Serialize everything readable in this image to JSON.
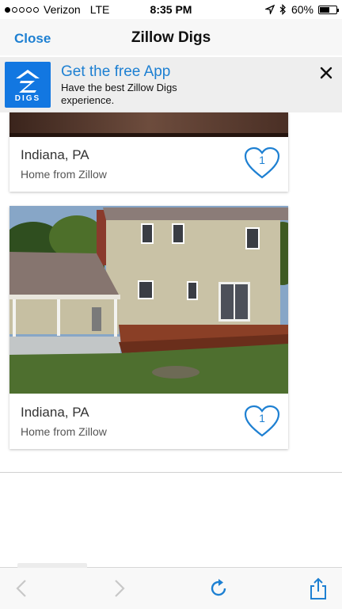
{
  "status_bar": {
    "carrier": "Verizon",
    "network": "LTE",
    "time": "8:35 PM",
    "battery": "60%",
    "battery_level": 0.6,
    "icons": [
      "signal-dots-icon",
      "location-arrow-icon",
      "bluetooth-icon",
      "battery-icon"
    ]
  },
  "nav": {
    "close_label": "Close",
    "title": "Zillow Digs"
  },
  "banner": {
    "logo_text": "DIGS",
    "title": "Get the free App",
    "subtitle": "Have the best Zillow Digs experience.",
    "close_icon": "close-icon"
  },
  "listings": [
    {
      "city": "Indiana, PA",
      "source": "Home from Zillow",
      "likes": "1"
    },
    {
      "city": "Indiana, PA",
      "source": "Home from Zillow",
      "likes": "1"
    }
  ],
  "toolbar": {
    "icons": [
      "back-arrow-icon",
      "forward-arrow-icon",
      "reload-icon",
      "share-icon"
    ]
  },
  "colors": {
    "accent": "#1e80d2",
    "brand": "#1277e1"
  }
}
